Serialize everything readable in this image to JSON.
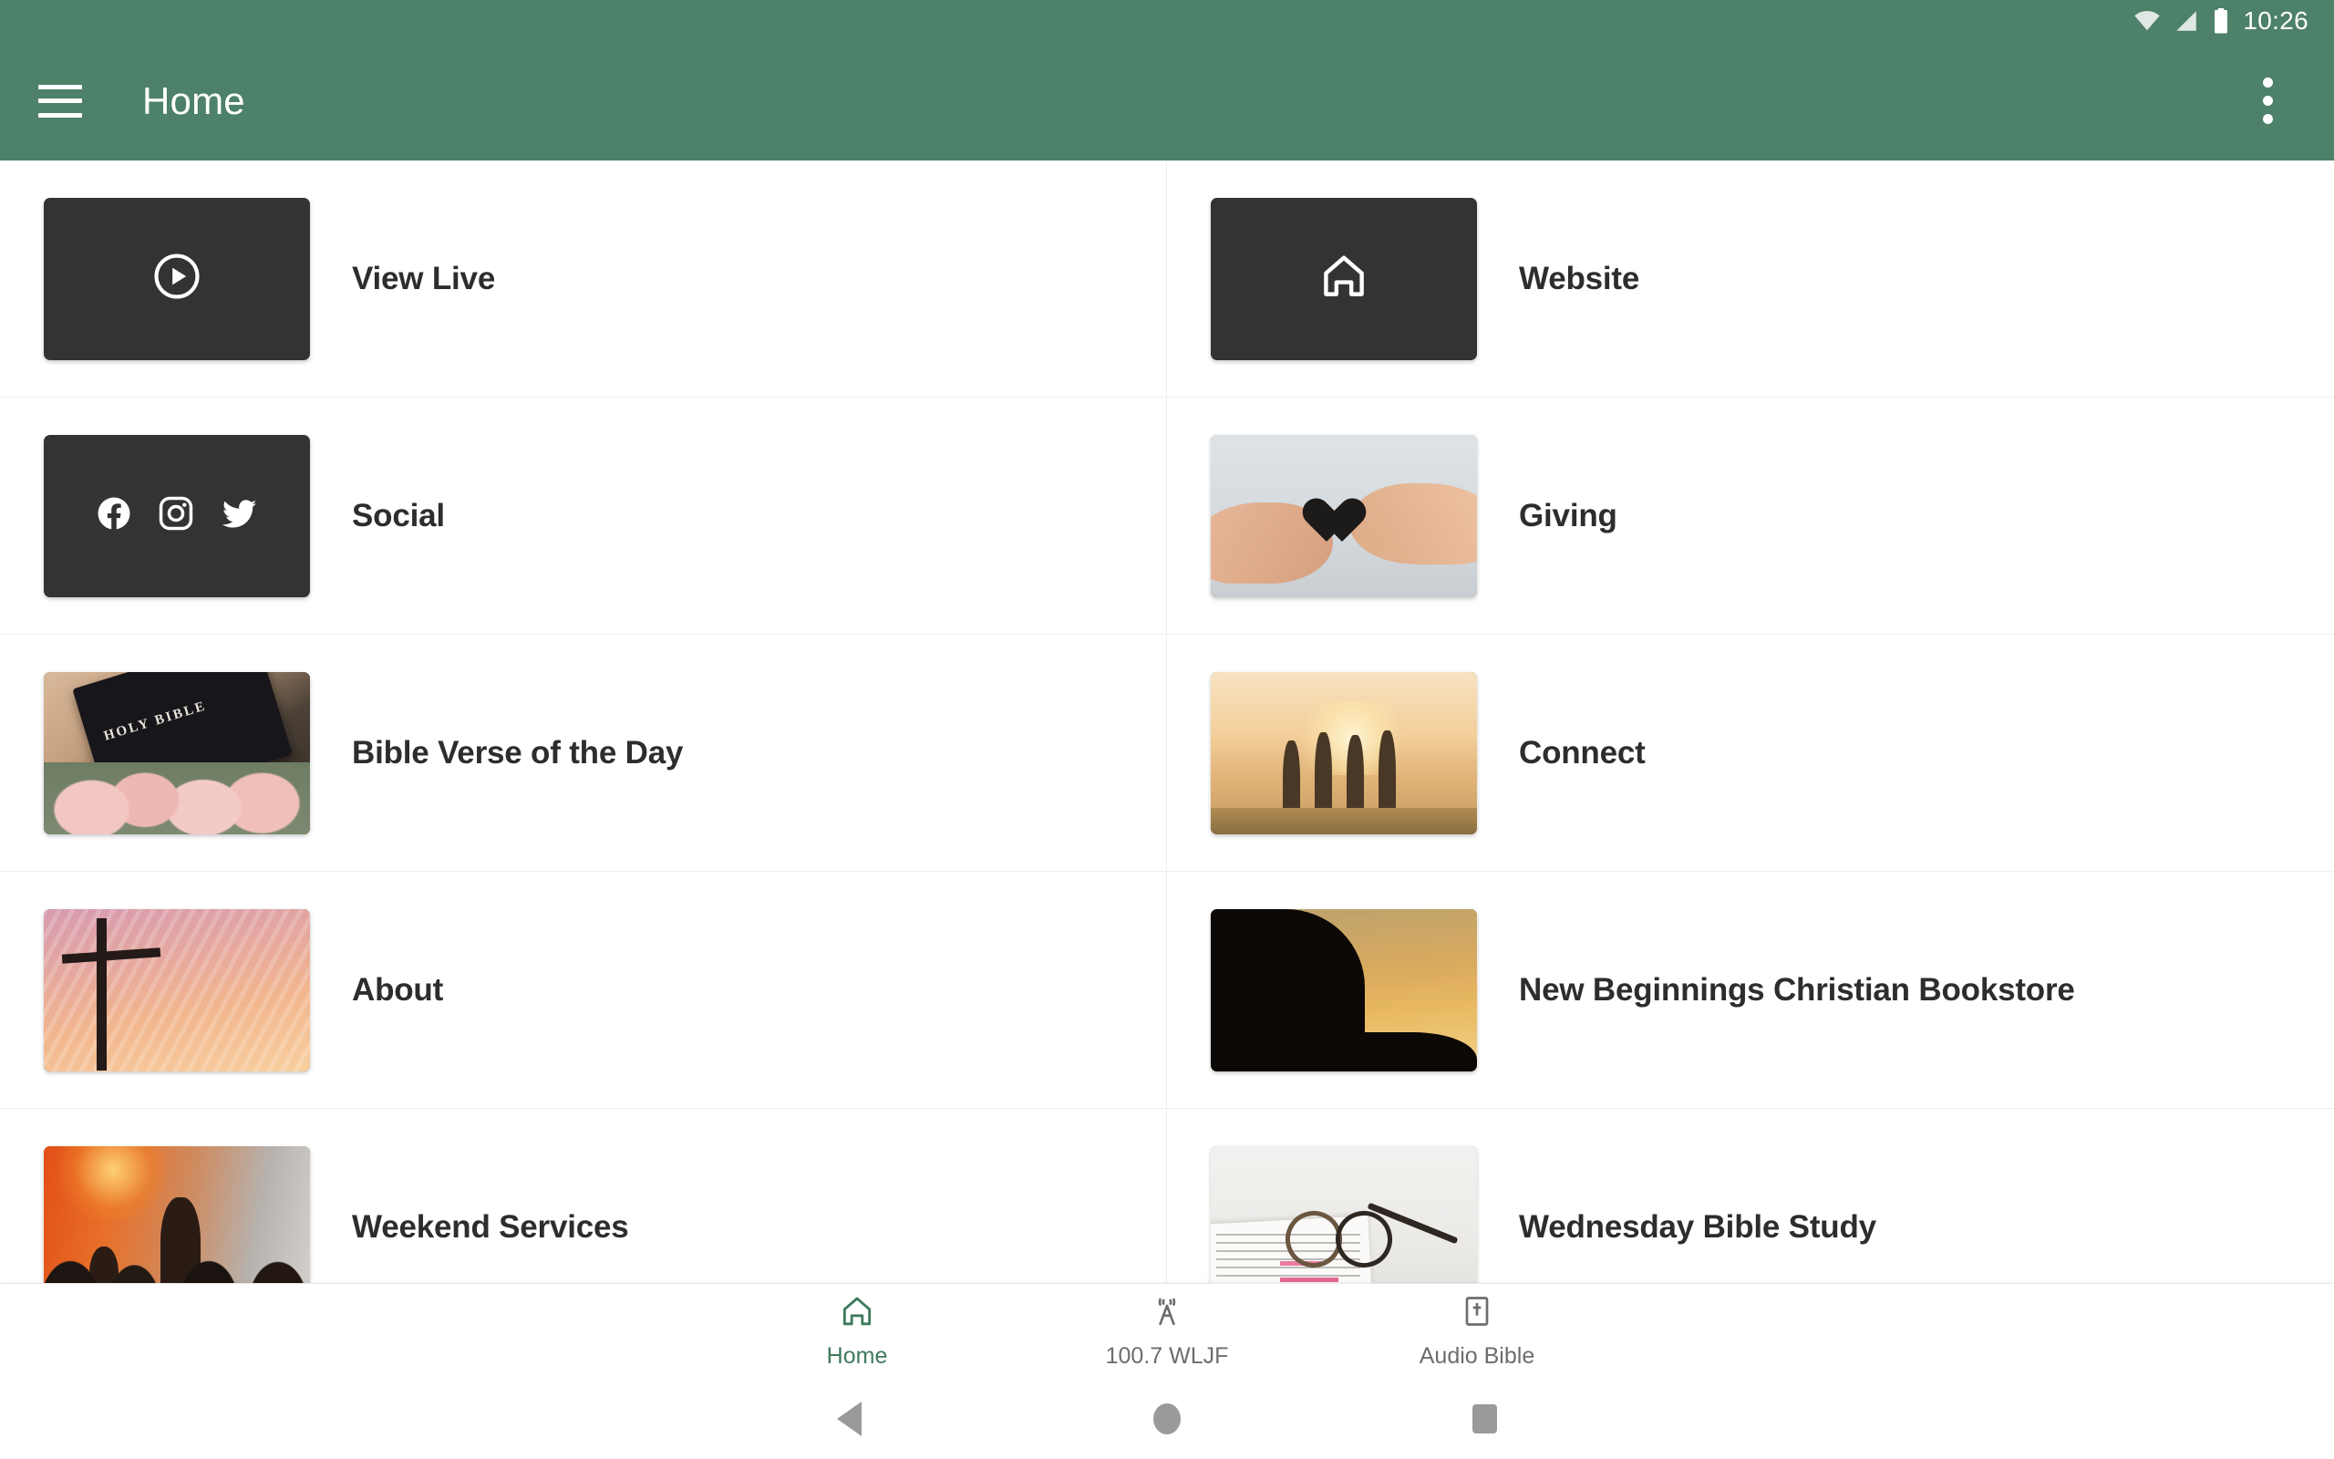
{
  "status_bar": {
    "time": "10:26",
    "icons": [
      "wifi-icon",
      "cellular-signal-icon",
      "battery-icon"
    ]
  },
  "app_bar": {
    "menu_icon": "hamburger-menu-icon",
    "title": "Home",
    "overflow_icon": "more-vertical-icon",
    "background_color": "#4d8169"
  },
  "tiles": [
    {
      "label": "View Live",
      "thumb_kind": "icon",
      "icon": "play-circle-icon"
    },
    {
      "label": "Website",
      "thumb_kind": "icon",
      "icon": "home-outline-icon"
    },
    {
      "label": "Social",
      "thumb_kind": "icons",
      "icons": [
        "facebook-icon",
        "instagram-icon",
        "twitter-icon"
      ]
    },
    {
      "label": "Giving",
      "thumb_kind": "photo",
      "photo": "hands-exchanging-paper-heart"
    },
    {
      "label": "Bible Verse of the Day",
      "thumb_kind": "photo",
      "photo": "holy-bible-with-tulips",
      "photo_text": "HOLY BIBLE"
    },
    {
      "label": "Connect",
      "thumb_kind": "photo",
      "photo": "four-friends-embracing-at-sunset"
    },
    {
      "label": "About",
      "thumb_kind": "photo",
      "photo": "cross-silhouette-pink-sunset-sky"
    },
    {
      "label": "New Beginnings Christian Bookstore",
      "thumb_kind": "photo",
      "photo": "person-reading-book-silhouette-sunset"
    },
    {
      "label": "Weekend Services",
      "thumb_kind": "photo",
      "photo": "worship-crowd-raised-hands"
    },
    {
      "label": "Wednesday Bible Study",
      "thumb_kind": "photo",
      "photo": "glasses-on-open-bible"
    }
  ],
  "bottom_nav": {
    "active_color": "#3f7a5c",
    "inactive_color": "#6d6d6d",
    "items": [
      {
        "label": "Home",
        "icon": "home-icon",
        "active": true
      },
      {
        "label": "100.7 WLJF",
        "icon": "radio-tower-icon",
        "active": false
      },
      {
        "label": "Audio Bible",
        "icon": "bible-book-icon",
        "active": false
      }
    ]
  },
  "system_nav": {
    "back": "back-triangle-icon",
    "home": "home-circle-icon",
    "recents": "recents-square-icon"
  }
}
